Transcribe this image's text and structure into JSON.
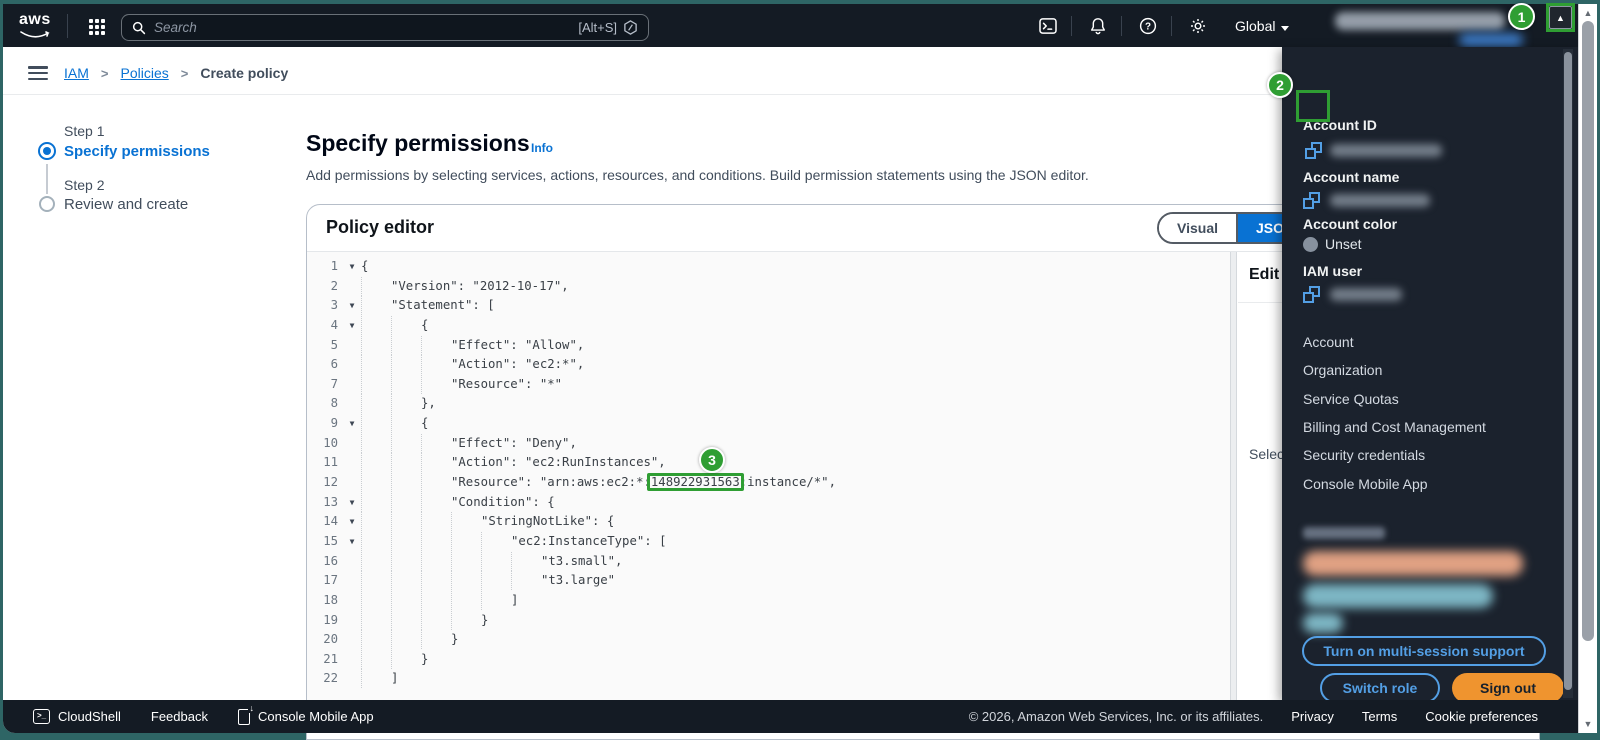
{
  "header": {
    "logo": "aws",
    "search": {
      "placeholder": "Search",
      "shortcut": "[Alt+S]"
    },
    "region": {
      "label": "Global"
    }
  },
  "breadcrumb": {
    "items": [
      {
        "label": "IAM",
        "link": true
      },
      {
        "label": "Policies",
        "link": true
      },
      {
        "label": "Create policy",
        "link": false
      }
    ]
  },
  "wizard": {
    "steps": [
      {
        "step": "Step 1",
        "title": "Specify permissions",
        "active": true
      },
      {
        "step": "Step 2",
        "title": "Review and create",
        "active": false
      }
    ]
  },
  "content": {
    "title": "Specify permissions",
    "info_label": "Info",
    "description": "Add permissions by selecting services, actions, resources, and conditions. Build permission statements using the JSON editor."
  },
  "policy_editor": {
    "title": "Policy editor",
    "toggle": {
      "left": "Visual",
      "right": "JSON",
      "selected": "JSON"
    },
    "side_panel": {
      "title": "Edit statement",
      "empty_text": "Select a statement"
    },
    "code": {
      "fold_lines": [
        1,
        3,
        4,
        9,
        13,
        14,
        15
      ],
      "lines": [
        {
          "n": 1,
          "indent": 0,
          "text": "{"
        },
        {
          "n": 2,
          "indent": 1,
          "text": "\"Version\": \"2012-10-17\","
        },
        {
          "n": 3,
          "indent": 1,
          "text": "\"Statement\": ["
        },
        {
          "n": 4,
          "indent": 2,
          "text": "{"
        },
        {
          "n": 5,
          "indent": 3,
          "text": "\"Effect\": \"Allow\","
        },
        {
          "n": 6,
          "indent": 3,
          "text": "\"Action\": \"ec2:*\","
        },
        {
          "n": 7,
          "indent": 3,
          "text": "\"Resource\": \"*\""
        },
        {
          "n": 8,
          "indent": 2,
          "text": "},"
        },
        {
          "n": 9,
          "indent": 2,
          "text": "{"
        },
        {
          "n": 10,
          "indent": 3,
          "text": "\"Effect\": \"Deny\","
        },
        {
          "n": 11,
          "indent": 3,
          "text": "\"Action\": \"ec2:RunInstances\","
        },
        {
          "n": 12,
          "indent": 3,
          "pre": "\"Resource\": \"arn:aws:ec2:*:",
          "hl": "148922931563",
          "post": ":instance/*\","
        },
        {
          "n": 13,
          "indent": 3,
          "text": "\"Condition\": {"
        },
        {
          "n": 14,
          "indent": 4,
          "text": "\"StringNotLike\": {"
        },
        {
          "n": 15,
          "indent": 5,
          "text": "\"ec2:InstanceType\": ["
        },
        {
          "n": 16,
          "indent": 6,
          "text": "\"t3.small\","
        },
        {
          "n": 17,
          "indent": 6,
          "text": "\"t3.large\""
        },
        {
          "n": 18,
          "indent": 5,
          "text": "]"
        },
        {
          "n": 19,
          "indent": 4,
          "text": "}"
        },
        {
          "n": 20,
          "indent": 3,
          "text": "}"
        },
        {
          "n": 21,
          "indent": 2,
          "text": "}"
        },
        {
          "n": 22,
          "indent": 1,
          "text": "]"
        }
      ]
    }
  },
  "account_menu": {
    "fields": [
      {
        "label": "Account ID",
        "type": "copy-blur",
        "blur_width": 112
      },
      {
        "label": "Account name",
        "type": "copy-blur",
        "blur_width": 100
      },
      {
        "label": "Account color",
        "type": "dot",
        "value": "Unset"
      },
      {
        "label": "IAM user",
        "type": "copy-blur",
        "blur_width": 72
      }
    ],
    "links": [
      "Account",
      "Organization",
      "Service Quotas",
      "Billing and Cost Management",
      "Security credentials",
      "Console Mobile App"
    ],
    "buttons": {
      "multi_session": "Turn on multi-session support",
      "switch_role": "Switch role",
      "sign_out": "Sign out"
    }
  },
  "footer": {
    "left": [
      {
        "label": "CloudShell",
        "icon": "cloudshell"
      },
      {
        "label": "Feedback"
      },
      {
        "label": "Console Mobile App",
        "icon": "mobile"
      }
    ],
    "copyright": "© 2026, Amazon Web Services, Inc. or its affiliates.",
    "links": [
      "Privacy",
      "Terms",
      "Cookie preferences"
    ]
  },
  "annotations": {
    "one": "1",
    "two": "2",
    "three": "3"
  },
  "colors": {
    "accent_blue": "#0972d3",
    "dark_blue_link": "#539fe5",
    "annotation_green": "#2f9e33",
    "signout_orange": "#ef942f"
  }
}
